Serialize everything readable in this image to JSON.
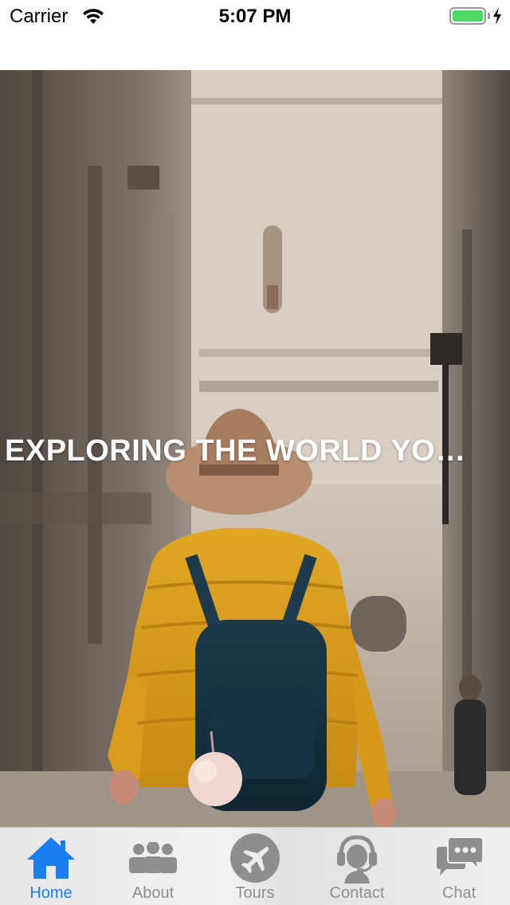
{
  "status_bar": {
    "carrier": "Carrier",
    "time": "5:07 PM",
    "battery_color": "#4cd964"
  },
  "hero": {
    "title": "EXPLORING THE WORLD YO…",
    "image": "traveler-in-yellow-jacket-photo"
  },
  "tab_bar": {
    "active_color": "#1a7df0",
    "inactive_color": "#8e8e8e",
    "tabs": [
      {
        "label": "Home",
        "icon": "home-icon",
        "active": true
      },
      {
        "label": "About",
        "icon": "group-icon",
        "active": false
      },
      {
        "label": "Tours",
        "icon": "airplane-icon",
        "active": false
      },
      {
        "label": "Contact",
        "icon": "support-agent-icon",
        "active": false
      },
      {
        "label": "Chat",
        "icon": "chat-bubbles-icon",
        "active": false
      }
    ]
  }
}
